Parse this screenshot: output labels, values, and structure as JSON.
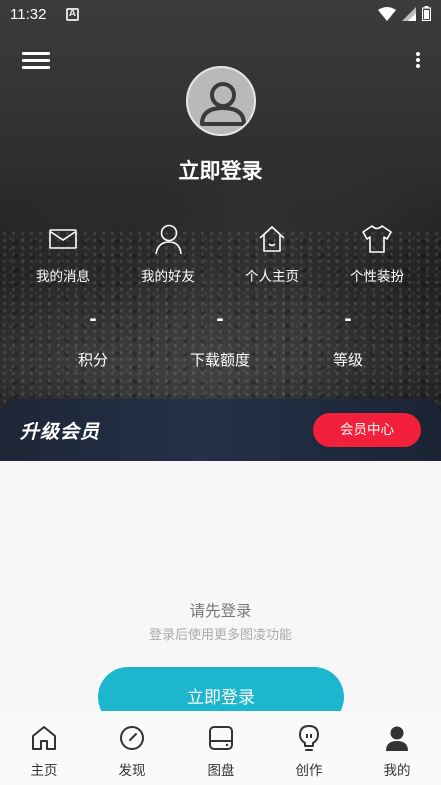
{
  "status_bar": {
    "time": "11:32"
  },
  "header": {
    "login_title": "立即登录"
  },
  "quick_links": [
    {
      "label": "我的消息",
      "icon": "mail-icon"
    },
    {
      "label": "我的好友",
      "icon": "person-icon"
    },
    {
      "label": "个人主页",
      "icon": "home-icon"
    },
    {
      "label": "个性装扮",
      "icon": "shirt-icon"
    }
  ],
  "stats": [
    {
      "value": "-",
      "label": "积分"
    },
    {
      "value": "-",
      "label": "下载额度"
    },
    {
      "value": "-",
      "label": "等级"
    }
  ],
  "vip": {
    "title": "升级会员",
    "button": "会员中心",
    "button_color": "#f2203b"
  },
  "main": {
    "prompt": "请先登录",
    "subprompt": "登录后使用更多图凌功能",
    "login_button": "立即登录",
    "accent": "#1cb6cf"
  },
  "tabbar": [
    {
      "label": "主页",
      "icon": "home-icon"
    },
    {
      "label": "发现",
      "icon": "compass-icon"
    },
    {
      "label": "图盘",
      "icon": "drive-icon"
    },
    {
      "label": "创作",
      "icon": "bulb-icon"
    },
    {
      "label": "我的",
      "icon": "user-icon"
    }
  ]
}
